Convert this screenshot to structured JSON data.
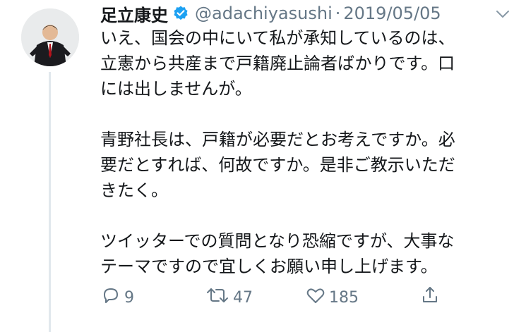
{
  "tweet": {
    "author_name": "足立康史",
    "handle": "@adachiyasushi",
    "separator": "·",
    "date": "2019/05/05",
    "paragraphs": [
      [
        "いえ、国会の中にいて私が承知しているのは、",
        "立憲から共産まで戸籍廃止論者ばかりです。口",
        "には出しませんが。"
      ],
      [
        "青野社長は、戸籍が必要だとお考えですか。必",
        "要だとすれば、何故ですか。是非ご教示いただ",
        "きたく。"
      ],
      [
        "ツイッターでの質問となり恐縮ですが、大事な",
        "テーマですので宜しくお願い申し上げます。"
      ]
    ],
    "reply_count": "9",
    "retweet_count": "47",
    "like_count": "185"
  },
  "icons": {
    "verified": "verified-badge-icon",
    "caret": "chevron-down-icon",
    "reply": "reply-icon",
    "retweet": "retweet-icon",
    "like": "heart-icon",
    "share": "share-icon"
  },
  "colors": {
    "text_primary": "#14171a",
    "text_secondary": "#657786",
    "verified_blue": "#1da1f2",
    "thread_line": "#e1e8ed"
  }
}
